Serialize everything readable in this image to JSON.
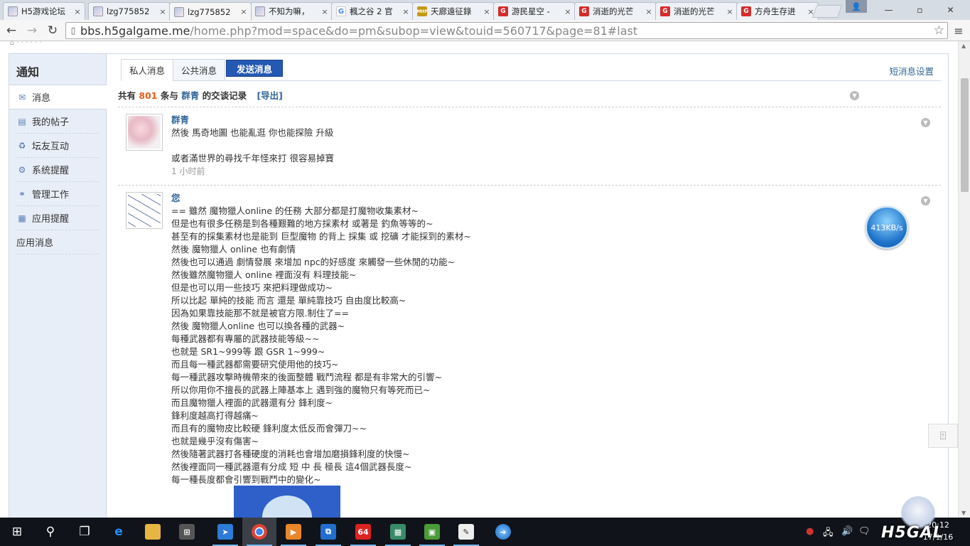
{
  "browser": {
    "tabs": [
      {
        "label": "H5游戏论坛",
        "favicon": "avatar-favicon"
      },
      {
        "label": "lzg775852",
        "favicon": "avatar-favicon"
      },
      {
        "label": "lzg775852",
        "favicon": "avatar-favicon",
        "active": true
      },
      {
        "label": "不知为嘛，",
        "favicon": "avatar-favicon"
      },
      {
        "label": "楓之谷 2 官",
        "favicon": "google-favicon"
      },
      {
        "label": "天廊遠征錄",
        "favicon": "mhf-favicon"
      },
      {
        "label": "游民星空 -",
        "favicon": "gamersky-favicon"
      },
      {
        "label": "消逝的光芒",
        "favicon": "gamersky-favicon"
      },
      {
        "label": "消逝的光芒",
        "favicon": "gamersky-favicon"
      },
      {
        "label": "方舟生存进",
        "favicon": "gamersky-favicon"
      }
    ],
    "tab_close": "×",
    "url_host": "bbs.h5galgame.me",
    "url_rest": "/home.php?mod=space&do=pm&subop=view&touid=560717&page=81#last",
    "window_controls": {
      "minimize": "—",
      "maximize": "▫",
      "close": "✕"
    }
  },
  "sidebar": {
    "title": "通知",
    "items": [
      {
        "label": "消息",
        "icon": "mail-icon",
        "active": true
      },
      {
        "label": "我的帖子",
        "icon": "document-icon"
      },
      {
        "label": "坛友互动",
        "icon": "recycle-icon"
      },
      {
        "label": "系统提醒",
        "icon": "gear-icon"
      },
      {
        "label": "管理工作",
        "icon": "link-icon"
      },
      {
        "label": "应用提醒",
        "icon": "grid-icon"
      },
      {
        "label": "应用消息",
        "icon": ""
      }
    ]
  },
  "main": {
    "tabs": [
      {
        "label": "私人消息",
        "active": true
      },
      {
        "label": "公共消息"
      }
    ],
    "send_button": "发送消息",
    "settings_link": "短消息设置",
    "summary": {
      "prefix": "共有",
      "count": "801",
      "middle": "条与",
      "partner": "群青",
      "suffix": "的交谈记录",
      "export": "[导出]"
    }
  },
  "messages": [
    {
      "author": "群青",
      "lines": [
        "然後 馬奇地圖  也能亂逛  你也能探險 升級",
        "",
        "或者滿世界的尋找千年怪來打  很容易掉寶"
      ],
      "time": "1 小时前"
    },
    {
      "author": "您",
      "lines": [
        "== 雖然 魔物獵人online 的任務 大部分都是打魔物收集素材~",
        "但是也有很多任務是到各種艱難的地方採素材 或著是 釣魚等等的~",
        "甚至有的採集素材也是能到 巨型魔物 的背上 採集 或 挖礦 才能採到的素材~",
        "然後 魔物獵人 online 也有劇情",
        "然後也可以通過 劇情發展 來增加 npc的好感度 來觸發一些休閒的功能~",
        "然後雖然魔物獵人 online 裡面沒有 料理技能~",
        "但是也可以用一些技巧 來把料理做成功~",
        "所以比起 單純的技能 而言 還是 單純靠技巧 自由度比較高~",
        "因為如果靠技能那不就是被官方限.制住了==",
        "然後 魔物獵人online 也可以換各種的武器~",
        "每種武器都有專屬的武器技能等級~~",
        "也就是 SR1~999等 跟 GSR 1~999~",
        "而且每一種武器都需要研究使用他的技巧~",
        "每一種武器攻擊時機帶來的後面整體 戰鬥流程 都是有非常大的引響~",
        "所以你用你不擅長的武器上陣基本上 遇到強的魔物只有等死而已~",
        "而且魔物獵人裡面的武器還有分 鋒利度~",
        "鋒利度越高打得越痛~",
        "而且有的魔物皮比較硬 鋒利度太低反而會彈刀~~",
        "也就是幾乎沒有傷害~",
        "然後隨著武器打各種硬度的消耗也會增加磨損鋒利度的快慢~",
        "然後裡面同一種武器還有分成 短 中 長 極長 這4個武器長度~",
        "每一種長度都會引響到戰鬥中的變化~"
      ]
    }
  ],
  "speed_widget": "413KB/s",
  "backtop_icon": "back-to-top-icon",
  "taskbar": {
    "clock_time": "20:12",
    "clock_date": "17/1/16",
    "logo_text": "H5GAL"
  }
}
